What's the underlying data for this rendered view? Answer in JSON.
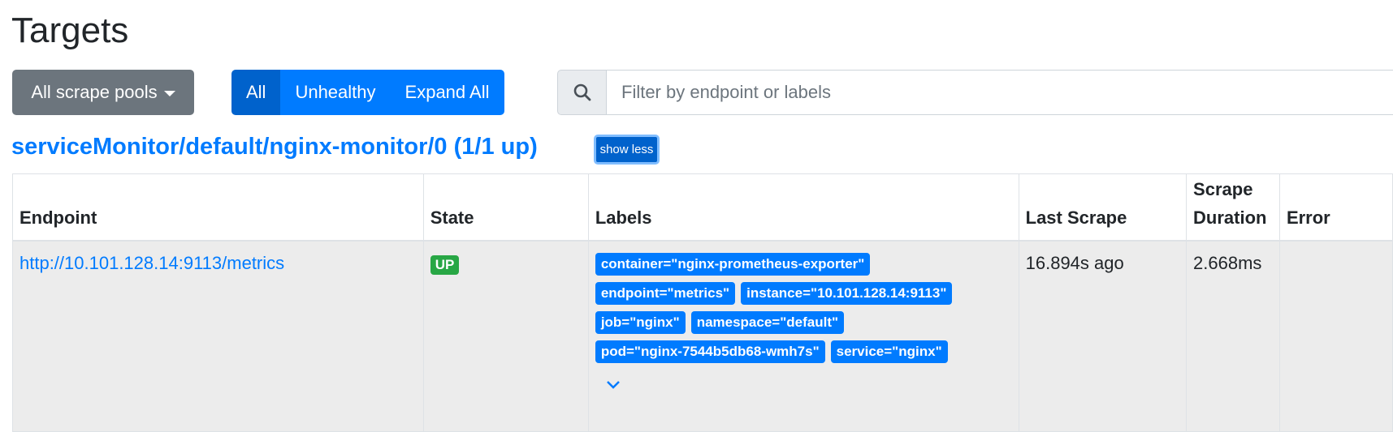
{
  "page": {
    "title": "Targets"
  },
  "controls": {
    "scrape_pools_label": "All scrape pools",
    "filters": [
      "All",
      "Unhealthy",
      "Expand All"
    ],
    "search_placeholder": "Filter by endpoint or labels"
  },
  "pool": {
    "title": "serviceMonitor/default/nginx-monitor/0 (1/1 up)",
    "toggle_label": "show less"
  },
  "table": {
    "headers": {
      "endpoint": "Endpoint",
      "state": "State",
      "labels": "Labels",
      "last_scrape": "Last Scrape",
      "scrape_duration": "Scrape Duration",
      "error": "Error"
    },
    "rows": [
      {
        "endpoint": "http://10.101.128.14:9113/metrics",
        "state": "UP",
        "labels": [
          "container=\"nginx-prometheus-exporter\"",
          "endpoint=\"metrics\"",
          "instance=\"10.101.128.14:9113\"",
          "job=\"nginx\"",
          "namespace=\"default\"",
          "pod=\"nginx-7544b5db68-wmh7s\"",
          "service=\"nginx\""
        ],
        "last_scrape": "16.894s ago",
        "scrape_duration": "2.668ms",
        "error": ""
      }
    ]
  },
  "colors": {
    "primary": "#007bff",
    "success": "#28a745",
    "secondary": "#6c757d"
  },
  "icons": {
    "search": "search-icon",
    "expand": "chevron-down-icon"
  }
}
